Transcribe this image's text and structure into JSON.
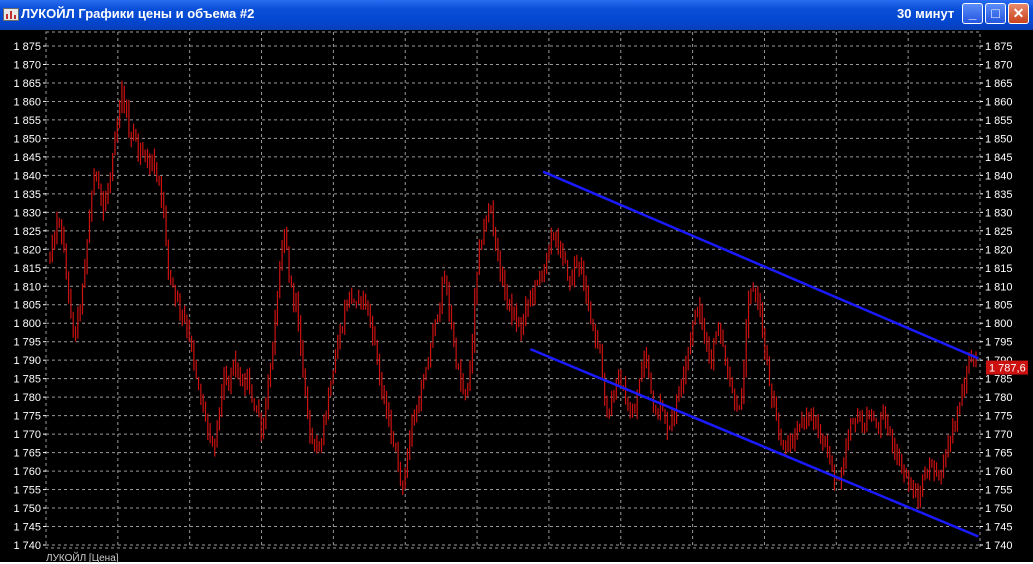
{
  "window": {
    "title": "ЛУКОЙЛ Графики цены и объема #2",
    "interval": "30 минут",
    "buttons": {
      "minimize": "_",
      "maximize": "□",
      "close": "✕"
    }
  },
  "bottom_label": "ЛУКОЙЛ [Цена]",
  "colors": {
    "price": "#cc1111",
    "channel": "#1a1aff",
    "grid": "#9a9a9a",
    "background": "#000000",
    "last_price_bg": "#cc1111"
  },
  "chart_data": {
    "type": "line",
    "title": "",
    "xlabel": "",
    "ylabel": "",
    "ylim": [
      1740,
      1875
    ],
    "yticks": [
      "1 740",
      "1 745",
      "1 750",
      "1 755",
      "1 760",
      "1 765",
      "1 770",
      "1 775",
      "1 780",
      "1 785",
      "1 790",
      "1 795",
      "1 800",
      "1 805",
      "1 810",
      "1 815",
      "1 820",
      "1 825",
      "1 830",
      "1 835",
      "1 840",
      "1 845",
      "1 850",
      "1 855",
      "1 860",
      "1 865",
      "1 870",
      "1 875"
    ],
    "last_price": "1 787,6",
    "n_bars": 400,
    "series": [
      {
        "values": [
          1818,
          1822,
          1828,
          1825,
          1815,
          1808,
          1795,
          1800,
          1805,
          1812,
          1825,
          1835,
          1842,
          1838,
          1830,
          1835,
          1840,
          1848,
          1855,
          1862,
          1858,
          1850,
          1852,
          1848,
          1845,
          1847,
          1842,
          1845,
          1840,
          1838,
          1830,
          1815,
          1812,
          1808,
          1805,
          1802,
          1800,
          1795,
          1788,
          1782,
          1778,
          1775,
          1768,
          1765,
          1772,
          1780,
          1785,
          1782,
          1790,
          1788,
          1785,
          1782,
          1785,
          1780,
          1778,
          1775,
          1770,
          1780,
          1788,
          1795,
          1810,
          1818,
          1825,
          1812,
          1808,
          1805,
          1792,
          1785,
          1775,
          1768,
          1765,
          1768,
          1772,
          1778,
          1785,
          1790,
          1795,
          1800,
          1805,
          1808,
          1806,
          1804,
          1808,
          1806,
          1802,
          1798,
          1792,
          1785,
          1778,
          1775,
          1770,
          1765,
          1760,
          1755,
          1765,
          1770,
          1775,
          1778,
          1782,
          1786,
          1792,
          1798,
          1802,
          1808,
          1812,
          1805,
          1798,
          1790,
          1785,
          1780,
          1782,
          1790,
          1808,
          1818,
          1825,
          1828,
          1832,
          1825,
          1818,
          1812,
          1808,
          1805,
          1802,
          1800,
          1798,
          1802,
          1806,
          1808,
          1810,
          1812,
          1815,
          1818,
          1822,
          1825,
          1820,
          1818,
          1815,
          1810,
          1815,
          1818,
          1814,
          1808,
          1805,
          1800,
          1795,
          1792,
          1780,
          1775,
          1780,
          1783,
          1785,
          1782,
          1778,
          1774,
          1776,
          1782,
          1788,
          1792,
          1785,
          1778,
          1776,
          1778,
          1773,
          1772,
          1775,
          1778,
          1783,
          1788,
          1792,
          1798,
          1802,
          1805,
          1798,
          1794,
          1790,
          1795,
          1800,
          1795,
          1790,
          1785,
          1780,
          1778,
          1776,
          1790,
          1805,
          1810,
          1808,
          1805,
          1795,
          1788,
          1780,
          1775,
          1770,
          1768,
          1766,
          1768,
          1770,
          1772,
          1774,
          1772,
          1776,
          1774,
          1772,
          1770,
          1768,
          1765,
          1760,
          1758,
          1756,
          1760,
          1768,
          1772,
          1774,
          1775,
          1772,
          1774,
          1775,
          1773,
          1772,
          1774,
          1774,
          1770,
          1768,
          1765,
          1762,
          1760,
          1758,
          1755,
          1753,
          1752,
          1758,
          1760,
          1762,
          1760,
          1758,
          1762,
          1765,
          1768,
          1772,
          1776,
          1780,
          1785,
          1790,
          1792,
          1788
        ]
      }
    ],
    "channel": [
      {
        "name": "",
        "x1": 212.5,
        "y1": 1841,
        "x2": 400,
        "y2": 1790.5
      },
      {
        "name": "",
        "x1": 207,
        "y1": 1793,
        "x2": 400,
        "y2": 1742.3
      }
    ]
  }
}
